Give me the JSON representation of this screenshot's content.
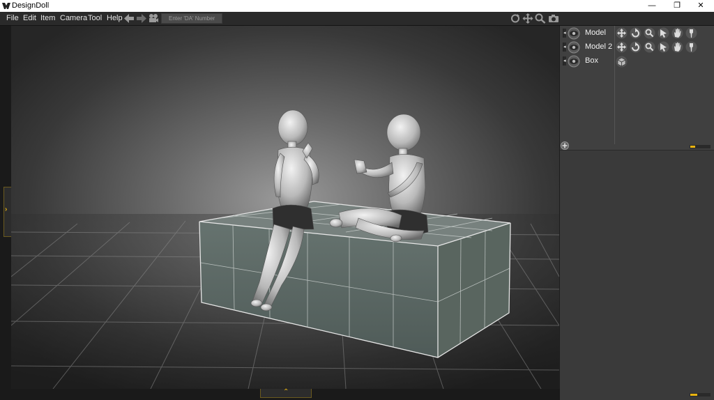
{
  "app": {
    "title": "DesignDoll"
  },
  "window_controls": {
    "minimize": "—",
    "restore": "❐",
    "close": "✕"
  },
  "menu": {
    "items": [
      "File",
      "Edit",
      "Item",
      "Camera",
      "Tool",
      "Help"
    ]
  },
  "toolbar": {
    "number_field_placeholder": "Enter 'DA' Number",
    "left_icons": [
      "back-arrow-icon",
      "forward-arrow-icon",
      "camera-record-icon"
    ],
    "right_icons": [
      "rotate-view-icon",
      "pan-view-icon",
      "zoom-view-icon",
      "snapshot-camera-icon"
    ]
  },
  "scene_list": {
    "items": [
      {
        "label": "Model",
        "tools": [
          "move-icon",
          "rotate-icon",
          "zoom-icon",
          "select-icon",
          "hand-icon",
          "pin-icon"
        ]
      },
      {
        "label": "Model 2",
        "tools": [
          "move-icon",
          "rotate-icon",
          "zoom-icon",
          "select-icon",
          "hand-icon",
          "pin-icon"
        ]
      },
      {
        "label": "Box",
        "tools": [
          "cube-icon"
        ]
      }
    ]
  },
  "panels": {
    "left_tab_glyph": "›",
    "bottom_tab_glyph": "⌃"
  },
  "colors": {
    "accent": "#e8b30f",
    "viewport_bg": "#2b2b2b",
    "panel_bg": "#3c3c3c",
    "box_face": "#5c6a66"
  }
}
